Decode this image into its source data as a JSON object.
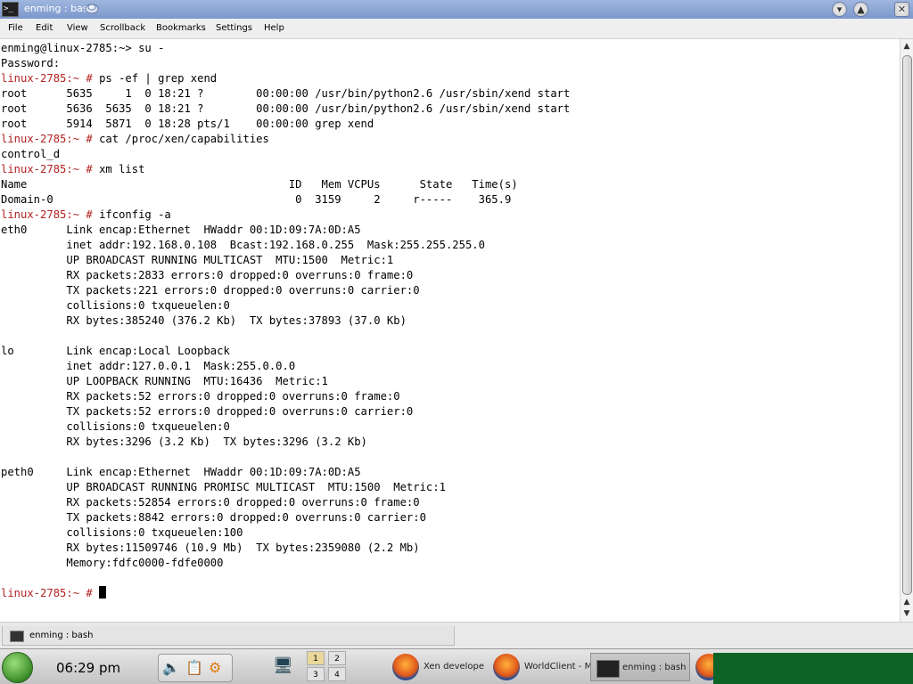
{
  "window": {
    "title": "enming : bash",
    "icon": "terminal-icon",
    "buttons": [
      "minimize",
      "maximize",
      "close"
    ]
  },
  "menu": [
    "File",
    "Edit",
    "View",
    "Scrollback",
    "Bookmarks",
    "Settings",
    "Help"
  ],
  "terminal": {
    "lines": [
      {
        "text": "enming@linux-2785:~> su -"
      },
      {
        "text": "Password:"
      },
      {
        "prompt": "linux-2785:~ # ",
        "text": "ps -ef | grep xend"
      },
      {
        "text": "root      5635     1  0 18:21 ?        00:00:00 /usr/bin/python2.6 /usr/sbin/xend start"
      },
      {
        "text": "root      5636  5635  0 18:21 ?        00:00:00 /usr/bin/python2.6 /usr/sbin/xend start"
      },
      {
        "text": "root      5914  5871  0 18:28 pts/1    00:00:00 grep xend"
      },
      {
        "prompt": "linux-2785:~ # ",
        "text": "cat /proc/xen/capabilities"
      },
      {
        "text": "control_d"
      },
      {
        "prompt": "linux-2785:~ # ",
        "text": "xm list"
      },
      {
        "text": "Name                                        ID   Mem VCPUs      State   Time(s)"
      },
      {
        "text": "Domain-0                                     0  3159     2     r-----    365.9"
      },
      {
        "prompt": "linux-2785:~ # ",
        "text": "ifconfig -a"
      },
      {
        "text": "eth0      Link encap:Ethernet  HWaddr 00:1D:09:7A:0D:A5"
      },
      {
        "text": "          inet addr:192.168.0.108  Bcast:192.168.0.255  Mask:255.255.255.0"
      },
      {
        "text": "          UP BROADCAST RUNNING MULTICAST  MTU:1500  Metric:1"
      },
      {
        "text": "          RX packets:2833 errors:0 dropped:0 overruns:0 frame:0"
      },
      {
        "text": "          TX packets:221 errors:0 dropped:0 overruns:0 carrier:0"
      },
      {
        "text": "          collisions:0 txqueuelen:0"
      },
      {
        "text": "          RX bytes:385240 (376.2 Kb)  TX bytes:37893 (37.0 Kb)"
      },
      {
        "text": ""
      },
      {
        "text": "lo        Link encap:Local Loopback"
      },
      {
        "text": "          inet addr:127.0.0.1  Mask:255.0.0.0"
      },
      {
        "text": "          UP LOOPBACK RUNNING  MTU:16436  Metric:1"
      },
      {
        "text": "          RX packets:52 errors:0 dropped:0 overruns:0 frame:0"
      },
      {
        "text": "          TX packets:52 errors:0 dropped:0 overruns:0 carrier:0"
      },
      {
        "text": "          collisions:0 txqueuelen:0"
      },
      {
        "text": "          RX bytes:3296 (3.2 Kb)  TX bytes:3296 (3.2 Kb)"
      },
      {
        "text": ""
      },
      {
        "text": "peth0     Link encap:Ethernet  HWaddr 00:1D:09:7A:0D:A5"
      },
      {
        "text": "          UP BROADCAST RUNNING PROMISC MULTICAST  MTU:1500  Metric:1"
      },
      {
        "text": "          RX packets:52854 errors:0 dropped:0 overruns:0 frame:0"
      },
      {
        "text": "          TX packets:8842 errors:0 dropped:0 overruns:0 carrier:0"
      },
      {
        "text": "          collisions:0 txqueuelen:100"
      },
      {
        "text": "          RX bytes:11509746 (10.9 Mb)  TX bytes:2359080 (2.2 Mb)"
      },
      {
        "text": "          Memory:fdfc0000-fdfe0000"
      },
      {
        "text": ""
      },
      {
        "prompt": "linux-2785:~ # ",
        "text": "",
        "cursor": true
      }
    ],
    "prompt_color": "#b22222"
  },
  "session_tab": {
    "label": "enming : bash",
    "icon": "terminal-icon"
  },
  "taskbar": {
    "clock": "06:29 pm",
    "tray_icons": [
      "speaker-icon",
      "clipboard-icon",
      "update-gear-icon"
    ],
    "pager": [
      "1",
      "2",
      "3",
      "4"
    ],
    "pager_active": "1",
    "tasks": [
      {
        "label": "Xen develope",
        "icon": "firefox-icon",
        "active": false
      },
      {
        "label": "WorldClient - M",
        "icon": "firefox-icon",
        "active": false
      },
      {
        "label": "enming : bash",
        "icon": "terminal-icon",
        "active": true
      }
    ],
    "accent": "#0c6426"
  }
}
